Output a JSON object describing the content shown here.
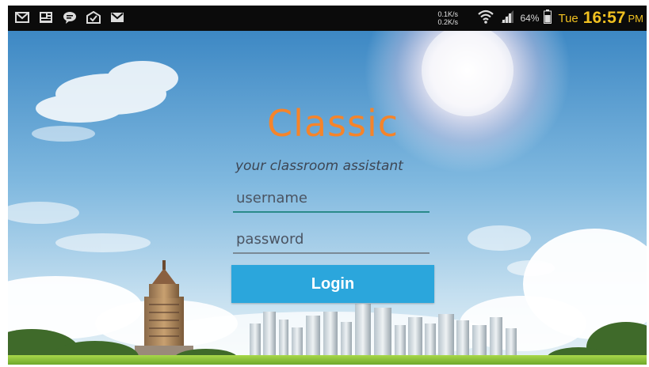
{
  "status_bar": {
    "net_up": "0.1K/s",
    "net_down": "0.2K/s",
    "battery": "64%",
    "day": "Tue",
    "time": "16:57",
    "ampm": "PM",
    "left_icons": [
      "mail-icon",
      "news-icon",
      "chat-icon",
      "envelope-check-icon",
      "gmail-icon"
    ],
    "right_icons": [
      "wifi-icon",
      "signal-icon",
      "battery-icon"
    ]
  },
  "login": {
    "app_title": "Classic",
    "tagline": "your classroom assistant",
    "username_placeholder": "username",
    "password_placeholder": "password",
    "login_label": "Login"
  },
  "colors": {
    "title": "#f5842a",
    "button": "#2ba6dc",
    "clock": "#f0c020",
    "username_underline": "#2a8a8a"
  }
}
